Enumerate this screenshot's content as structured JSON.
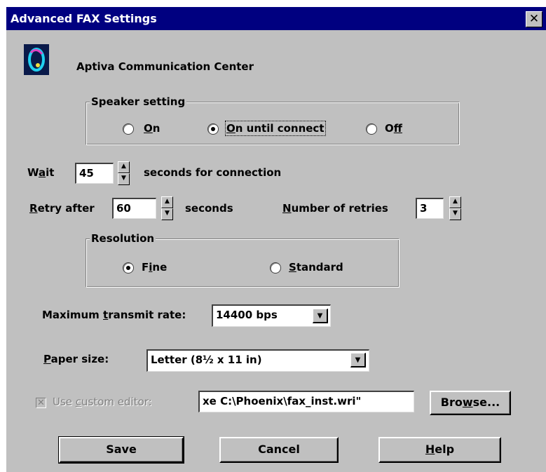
{
  "window": {
    "title": "Advanced FAX Settings",
    "close_glyph": "✕"
  },
  "header": {
    "app_name": "Aptiva Communication Center",
    "logo_icon": "aptiva-logo-icon"
  },
  "speaker": {
    "legend": "Speaker setting",
    "options": [
      {
        "label_ul": "O",
        "label_rest": "n",
        "selected": false
      },
      {
        "label_ul": "O",
        "label_rest": "n until connect",
        "selected": true
      },
      {
        "label_pre": "O",
        "label_ul": "f",
        "label_rest": "f",
        "selected": false
      }
    ]
  },
  "wait": {
    "label_pre": "W",
    "label_ul": "a",
    "label_rest": "it",
    "value": "45",
    "suffix": "seconds for connection"
  },
  "retry": {
    "label_ul": "R",
    "label_rest": "etry after",
    "value": "60",
    "suffix": "seconds"
  },
  "retries": {
    "label_ul": "N",
    "label_rest": "umber of retries",
    "value": "3"
  },
  "resolution": {
    "legend": "Resolution",
    "options": [
      {
        "label_pre": "F",
        "label_ul": "i",
        "label_rest": "ne",
        "selected": true
      },
      {
        "label_ul": "S",
        "label_rest": "tandard",
        "selected": false
      }
    ]
  },
  "transmit": {
    "label_pre": "Maximum ",
    "label_ul": "t",
    "label_rest": "ransmit rate:",
    "value": "14400 bps"
  },
  "paper": {
    "label_ul": "P",
    "label_rest": "aper size:",
    "value": "Letter (8½ x 11 in)"
  },
  "editor": {
    "label_pre": "Use ",
    "label_ul": "c",
    "label_rest": "ustom editor:",
    "checked": true,
    "enabled": false,
    "value": "xe  C:\\Phoenix\\fax_inst.wri\"",
    "browse_pre": "Bro",
    "browse_ul": "w",
    "browse_rest": "se..."
  },
  "buttons": {
    "save": "Save",
    "cancel": "Cancel",
    "help_ul": "H",
    "help_rest": "elp"
  },
  "colors": {
    "face": "#c0c0c0",
    "title": "#000080"
  }
}
